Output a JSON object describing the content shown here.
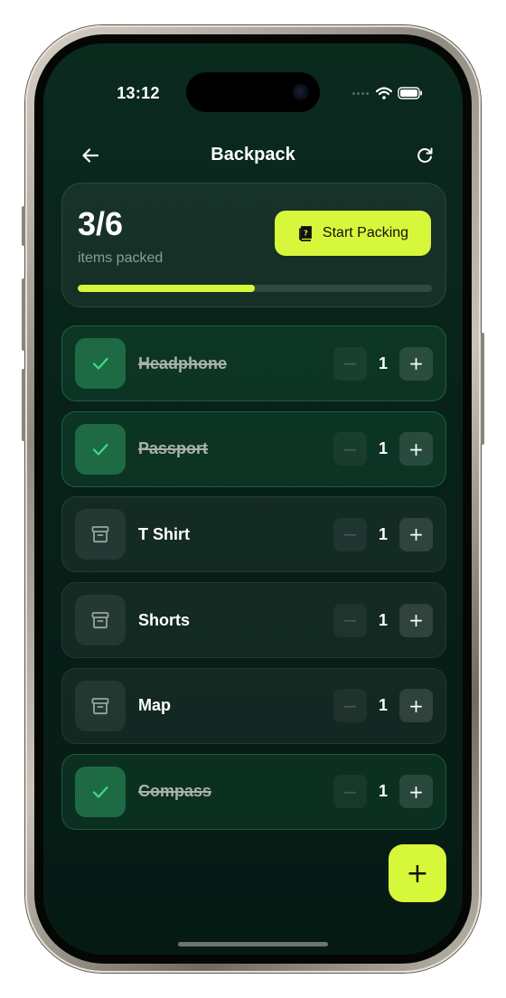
{
  "status_bar": {
    "time": "13:12"
  },
  "header": {
    "title": "Backpack"
  },
  "summary": {
    "count_text": "3/6",
    "subtitle": "items packed",
    "start_button_label": "Start Packing",
    "progress": 0.5
  },
  "items": [
    {
      "name": "Headphone",
      "quantity": "1",
      "packed": true
    },
    {
      "name": "Passport",
      "quantity": "1",
      "packed": true
    },
    {
      "name": "T Shirt",
      "quantity": "1",
      "packed": false
    },
    {
      "name": "Shorts",
      "quantity": "1",
      "packed": false
    },
    {
      "name": "Map",
      "quantity": "1",
      "packed": false
    },
    {
      "name": "Compass",
      "quantity": "1",
      "packed": true
    }
  ],
  "fab": {
    "symbol": "+"
  },
  "colors": {
    "accent": "#d7f73b",
    "background": "#0b2a1e",
    "packed_check": "#3ddc84"
  },
  "icons": {
    "back": "arrow-left-icon",
    "refresh": "refresh-icon",
    "start_packing": "book-icon",
    "packed": "check-icon",
    "unpacked": "archive-box-icon",
    "minus": "minus-icon",
    "plus": "plus-icon"
  }
}
